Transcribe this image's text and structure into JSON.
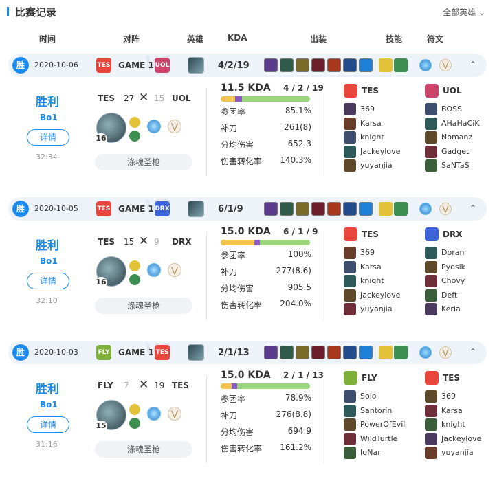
{
  "header": {
    "title": "比赛记录",
    "filter_label": "全部英雄"
  },
  "columns": {
    "time": "时间",
    "matchup": "对阵",
    "hero": "英雄",
    "kda": "KDA",
    "items": "出装",
    "skills": "技能",
    "runes": "符文"
  },
  "colors": {
    "accent": "#1c8bf0",
    "win": "#1c8bf0",
    "kill_bar": "#f3c34f",
    "death_bar": "#8b5cc4",
    "assist_bar": "#9bd67d"
  },
  "matches": [
    {
      "win_badge": "胜",
      "date": "2020-10-06",
      "game": "GAME 1",
      "kda_text": "4/2/19",
      "logo_left": "TES",
      "logo_right": "UOL",
      "result": "胜利",
      "bo": "Bo1",
      "detail_label": "详情",
      "duration": "32:34",
      "team_left": "TES",
      "score_left": "27",
      "team_right": "UOL",
      "score_right": "15",
      "level": "16",
      "hero_name": "涤魂圣枪",
      "kda_ratio_text": "11.5 KDA",
      "kda_small": "4 / 2 / 19",
      "kda_bar": {
        "kills": 4,
        "deaths": 2,
        "assists": 19
      },
      "stats": [
        {
          "label": "参团率",
          "value": "85.1%"
        },
        {
          "label": "补刀",
          "value": "261(8)"
        },
        {
          "label": "分均伤害",
          "value": "652.3"
        },
        {
          "label": "伤害转化率",
          "value": "140.3%"
        }
      ],
      "teamA": {
        "name": "TES",
        "players": [
          "369",
          "Karsa",
          "knight",
          "Jackeylove",
          "yuyanjia"
        ]
      },
      "teamB": {
        "name": "UOL",
        "players": [
          "BOSS",
          "AHaHaCiK",
          "Nomanz",
          "Gadget",
          "SaNTaS"
        ]
      }
    },
    {
      "win_badge": "胜",
      "date": "2020-10-05",
      "game": "GAME 1",
      "kda_text": "6/1/9",
      "logo_left": "TES",
      "logo_right": "DRX",
      "result": "胜利",
      "bo": "Bo1",
      "detail_label": "详情",
      "duration": "32:10",
      "team_left": "TES",
      "score_left": "15",
      "team_right": "DRX",
      "score_right": "9",
      "level": "16",
      "hero_name": "涤魂圣枪",
      "kda_ratio_text": "15.0 KDA",
      "kda_small": "6 / 1 / 9",
      "kda_bar": {
        "kills": 6,
        "deaths": 1,
        "assists": 9
      },
      "stats": [
        {
          "label": "参团率",
          "value": "100%"
        },
        {
          "label": "补刀",
          "value": "277(8.6)"
        },
        {
          "label": "分均伤害",
          "value": "905.5"
        },
        {
          "label": "伤害转化率",
          "value": "204.0%"
        }
      ],
      "teamA": {
        "name": "TES",
        "players": [
          "369",
          "Karsa",
          "knight",
          "Jackeylove",
          "yuyanjia"
        ]
      },
      "teamB": {
        "name": "DRX",
        "players": [
          "Doran",
          "Pyosik",
          "Chovy",
          "Deft",
          "Keria"
        ]
      }
    },
    {
      "win_badge": "胜",
      "date": "2020-10-03",
      "game": "GAME 1",
      "kda_text": "2/1/13",
      "logo_left": "FLY",
      "logo_right": "TES",
      "result": "胜利",
      "bo": "Bo1",
      "detail_label": "详情",
      "duration": "31:16",
      "team_left": "FLY",
      "score_left": "7",
      "team_right": "TES",
      "score_right": "19",
      "level": "15",
      "hero_name": "涤魂圣枪",
      "kda_ratio_text": "15.0 KDA",
      "kda_small": "2 / 1 / 13",
      "kda_bar": {
        "kills": 2,
        "deaths": 1,
        "assists": 13
      },
      "stats": [
        {
          "label": "参团率",
          "value": "78.9%"
        },
        {
          "label": "补刀",
          "value": "276(8.8)"
        },
        {
          "label": "分均伤害",
          "value": "694.9"
        },
        {
          "label": "伤害转化率",
          "value": "161.2%"
        }
      ],
      "teamA": {
        "name": "FLY",
        "players": [
          "Solo",
          "Santorin",
          "PowerOfEvil",
          "WildTurtle",
          "IgNar"
        ]
      },
      "teamB": {
        "name": "TES",
        "players": [
          "369",
          "Karsa",
          "knight",
          "Jackeylove",
          "yuyanjia"
        ]
      }
    }
  ]
}
